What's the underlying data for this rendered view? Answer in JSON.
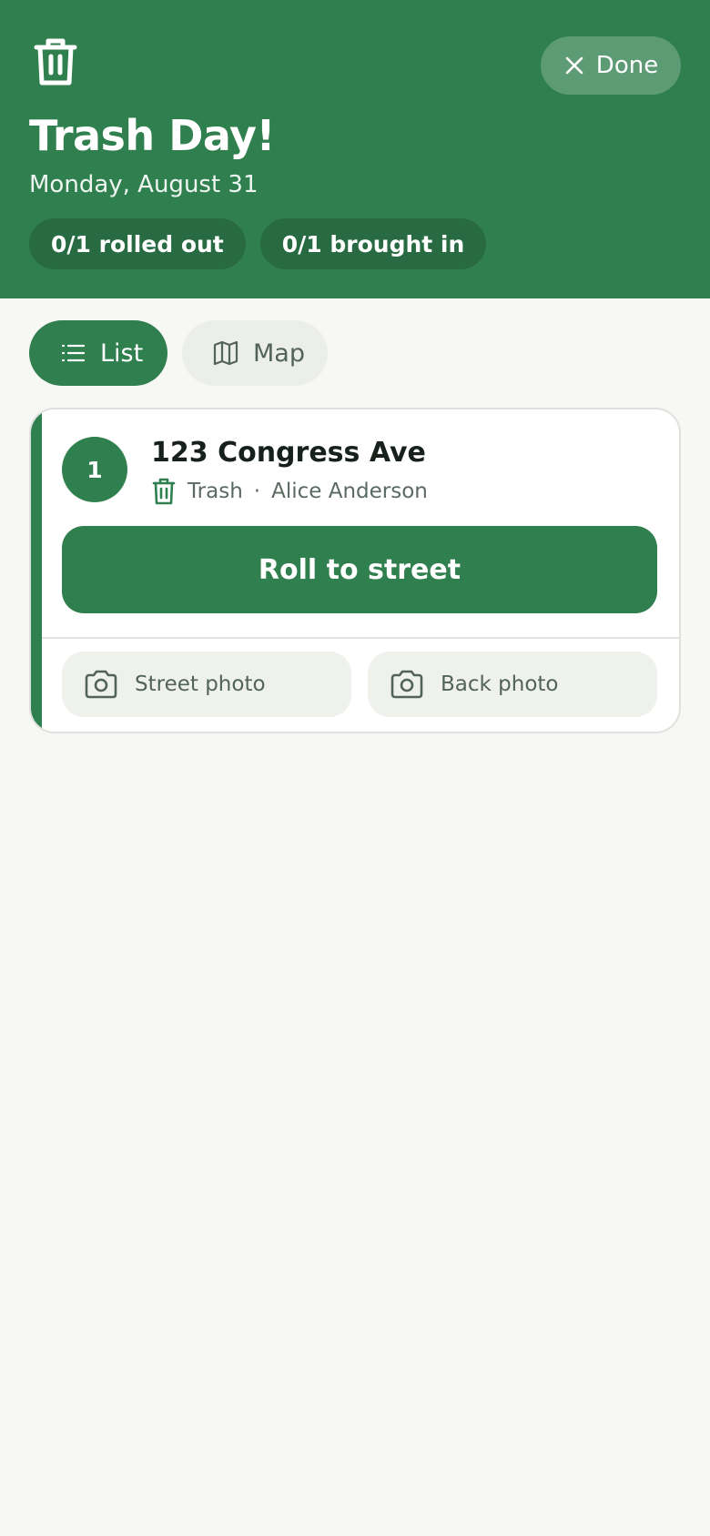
{
  "header": {
    "title": "Trash Day!",
    "date": "Monday, August 31",
    "done_label": "Done",
    "rolled_out": "0/1 rolled out",
    "brought_in": "0/1 brought in",
    "logo_icon": "trash-icon"
  },
  "view_toggle": {
    "list_label": "List",
    "map_label": "Map",
    "active": "list"
  },
  "stops": [
    {
      "number": "1",
      "address": "123 Congress Ave",
      "bin_type": "Trash",
      "separator": "·",
      "owner": "Alice Anderson",
      "action_label": "Roll to street",
      "street_photo_label": "Street photo",
      "back_photo_label": "Back photo"
    }
  ],
  "colors": {
    "brand_green": "#307f4e",
    "pill_dark_green": "#286b42",
    "background": "#f7f7f5"
  }
}
